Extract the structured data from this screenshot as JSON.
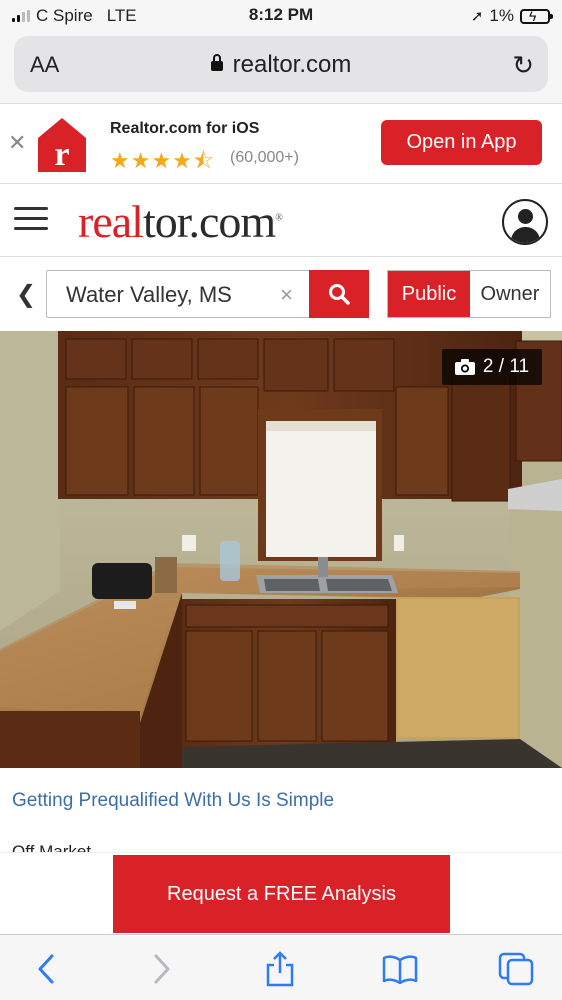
{
  "status_bar": {
    "carrier": "C Spire",
    "network": "LTE",
    "time": "8:12 PM",
    "battery": "1%"
  },
  "browser": {
    "text_size_label": "AA",
    "url": "realtor.com"
  },
  "app_banner": {
    "title": "Realtor.com for iOS",
    "stars": "★★★★⯪",
    "rating_count": "(60,000+)",
    "open_label": "Open in App"
  },
  "header": {
    "logo_red": "real",
    "logo_dark": "tor.com"
  },
  "search": {
    "value": "Water Valley, MS",
    "clear_glyph": "×",
    "toggle": {
      "public": "Public",
      "owner": "Owner"
    }
  },
  "gallery": {
    "counter": "2 / 11"
  },
  "content": {
    "prequal_link": "Getting Prequalified With Us Is Simple",
    "status": "Off Market"
  },
  "cta": {
    "label": "Request a FREE Analysis"
  },
  "colors": {
    "brand": "#d92228",
    "link": "#3d6ea8",
    "star": "#f3a91c"
  }
}
